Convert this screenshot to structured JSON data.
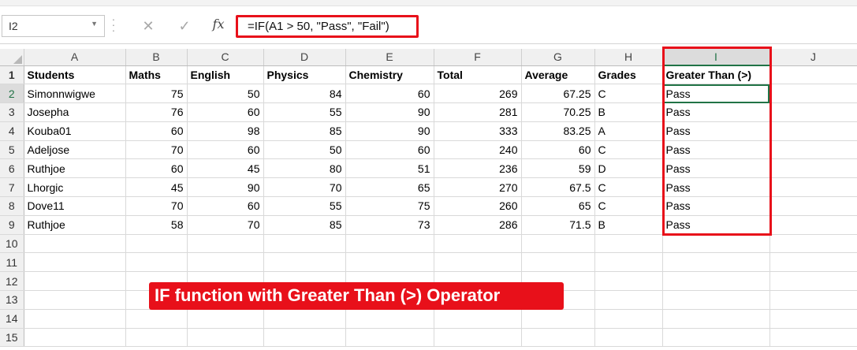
{
  "formula_bar": {
    "name_box": "I2",
    "cancel_icon": "✕",
    "enter_icon": "✓",
    "fx_label": "fx",
    "formula": "=IF(A1 > 50, \"Pass\", \"Fail\")"
  },
  "column_headers": [
    "A",
    "B",
    "C",
    "D",
    "E",
    "F",
    "G",
    "H",
    "I",
    "J"
  ],
  "row_numbers": [
    "1",
    "2",
    "3",
    "4",
    "5",
    "6",
    "7",
    "8",
    "9",
    "10",
    "11",
    "12",
    "13",
    "14",
    "15"
  ],
  "table": {
    "headers": [
      "Students",
      "Maths",
      "English",
      "Physics",
      "Chemistry",
      "Total",
      "Average",
      "Grades",
      "Greater Than (>)"
    ],
    "rows": [
      [
        "Simonnwigwe",
        "75",
        "50",
        "84",
        "60",
        "269",
        "67.25",
        "C",
        "Pass"
      ],
      [
        "Josepha",
        "76",
        "60",
        "55",
        "90",
        "281",
        "70.25",
        "B",
        "Pass"
      ],
      [
        "Kouba01",
        "60",
        "98",
        "85",
        "90",
        "333",
        "83.25",
        "A",
        "Pass"
      ],
      [
        "Adeljose",
        "70",
        "60",
        "50",
        "60",
        "240",
        "60",
        "C",
        "Pass"
      ],
      [
        "Ruthjoe",
        "60",
        "45",
        "80",
        "51",
        "236",
        "59",
        "D",
        "Pass"
      ],
      [
        "Lhorgic",
        "45",
        "90",
        "70",
        "65",
        "270",
        "67.5",
        "C",
        "Pass"
      ],
      [
        "Dove11",
        "70",
        "60",
        "55",
        "75",
        "260",
        "65",
        "C",
        "Pass"
      ],
      [
        "Ruthjoe",
        "58",
        "70",
        "85",
        "73",
        "286",
        "71.5",
        "B",
        "Pass"
      ]
    ]
  },
  "banner": "IF function with Greater Than (>) Operator",
  "colors": {
    "highlight_red": "#e8101a",
    "excel_green": "#217346",
    "header_gray": "#f0f0f0"
  }
}
